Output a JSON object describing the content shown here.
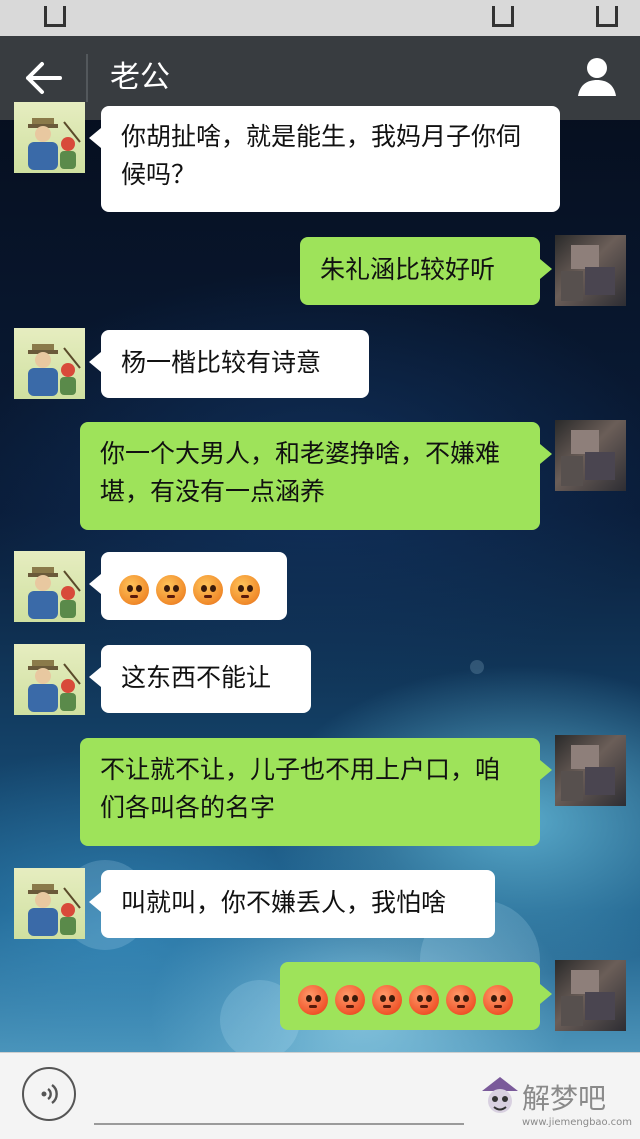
{
  "header": {
    "title": "老公"
  },
  "icons": {
    "back": "back-arrow-icon",
    "profile": "person-icon",
    "voice": "voice-icon"
  },
  "messages": [
    {
      "side": "in",
      "text": "你胡扯啥，就是能生，我妈月子你伺候吗？"
    },
    {
      "side": "out",
      "text": "朱礼涵比较好听"
    },
    {
      "side": "in",
      "text": "杨一楷比较有诗意"
    },
    {
      "side": "out",
      "text": "你一个大男人，和老婆挣啥，不嫌难堪，有没有一点涵养"
    },
    {
      "side": "in",
      "emoji": "flushed",
      "count": 4
    },
    {
      "side": "in",
      "text": "这东西不能让"
    },
    {
      "side": "out",
      "text": "不让就不让，儿子也不用上户口，咱们各叫各的名字"
    },
    {
      "side": "in",
      "text": "叫就叫，你不嫌丢人，我怕啥"
    },
    {
      "side": "out",
      "emoji": "angry",
      "count": 6
    }
  ],
  "watermark": {
    "text": "解梦吧",
    "url": "www.jiemengbao.com"
  },
  "colors": {
    "incoming_bubble": "#ffffff",
    "outgoing_bubble": "#9ee35a",
    "navbar": "#383c40"
  }
}
